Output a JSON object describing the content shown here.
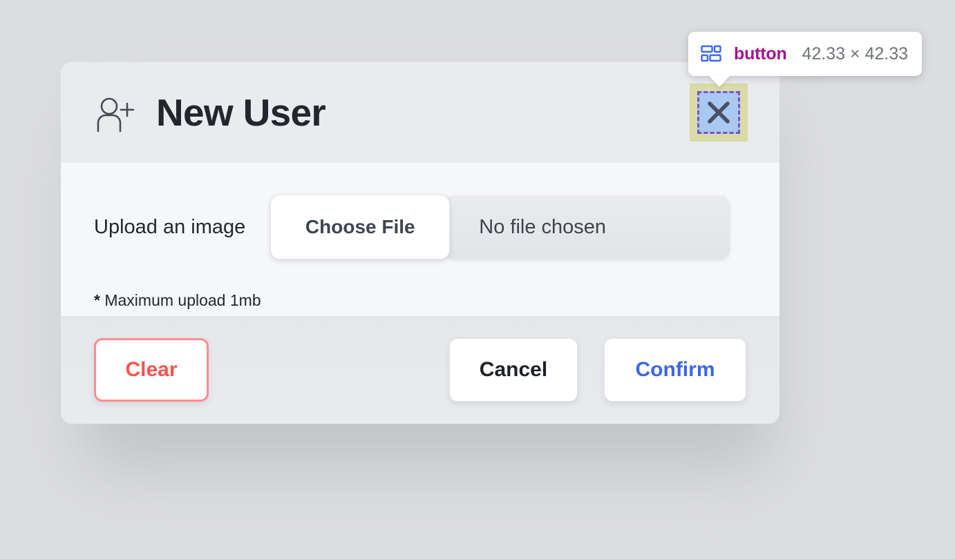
{
  "page": {
    "background_color": "#dcdddf"
  },
  "dialog": {
    "header": {
      "title": "New User",
      "icon": "user-plus-icon",
      "close_button_icon": "close-x-icon"
    },
    "body": {
      "upload_label": "Upload an image",
      "choose_file_label": "Choose File",
      "file_name_value": "No file chosen",
      "note_star": "*",
      "note_text": "Maximum upload 1mb"
    },
    "footer": {
      "clear_label": "Clear",
      "cancel_label": "Cancel",
      "confirm_label": "Confirm"
    }
  },
  "inspector": {
    "icon": "layout-grid-icon",
    "tag_name": "button",
    "dimensions": "42.33 × 42.33",
    "tag_color": "#a3158d",
    "dimensions_color": "#6f7479",
    "icon_color": "#3b66f0",
    "highlight": {
      "margin_color": "#f6b49c",
      "padding_color": "#d6dda0",
      "content_color": "#a9c8f2",
      "content_border_color": "#7a52c7"
    }
  },
  "colors": {
    "header_bg": "#eaebef",
    "body_bg": "#f6f7f9",
    "footer_bg": "#e8e9ed",
    "title_text": "#23262c",
    "clear_border": "#f98e8e",
    "clear_text": "#f9544f",
    "confirm_text": "#3b66f0",
    "cancel_text": "#1e2127"
  }
}
